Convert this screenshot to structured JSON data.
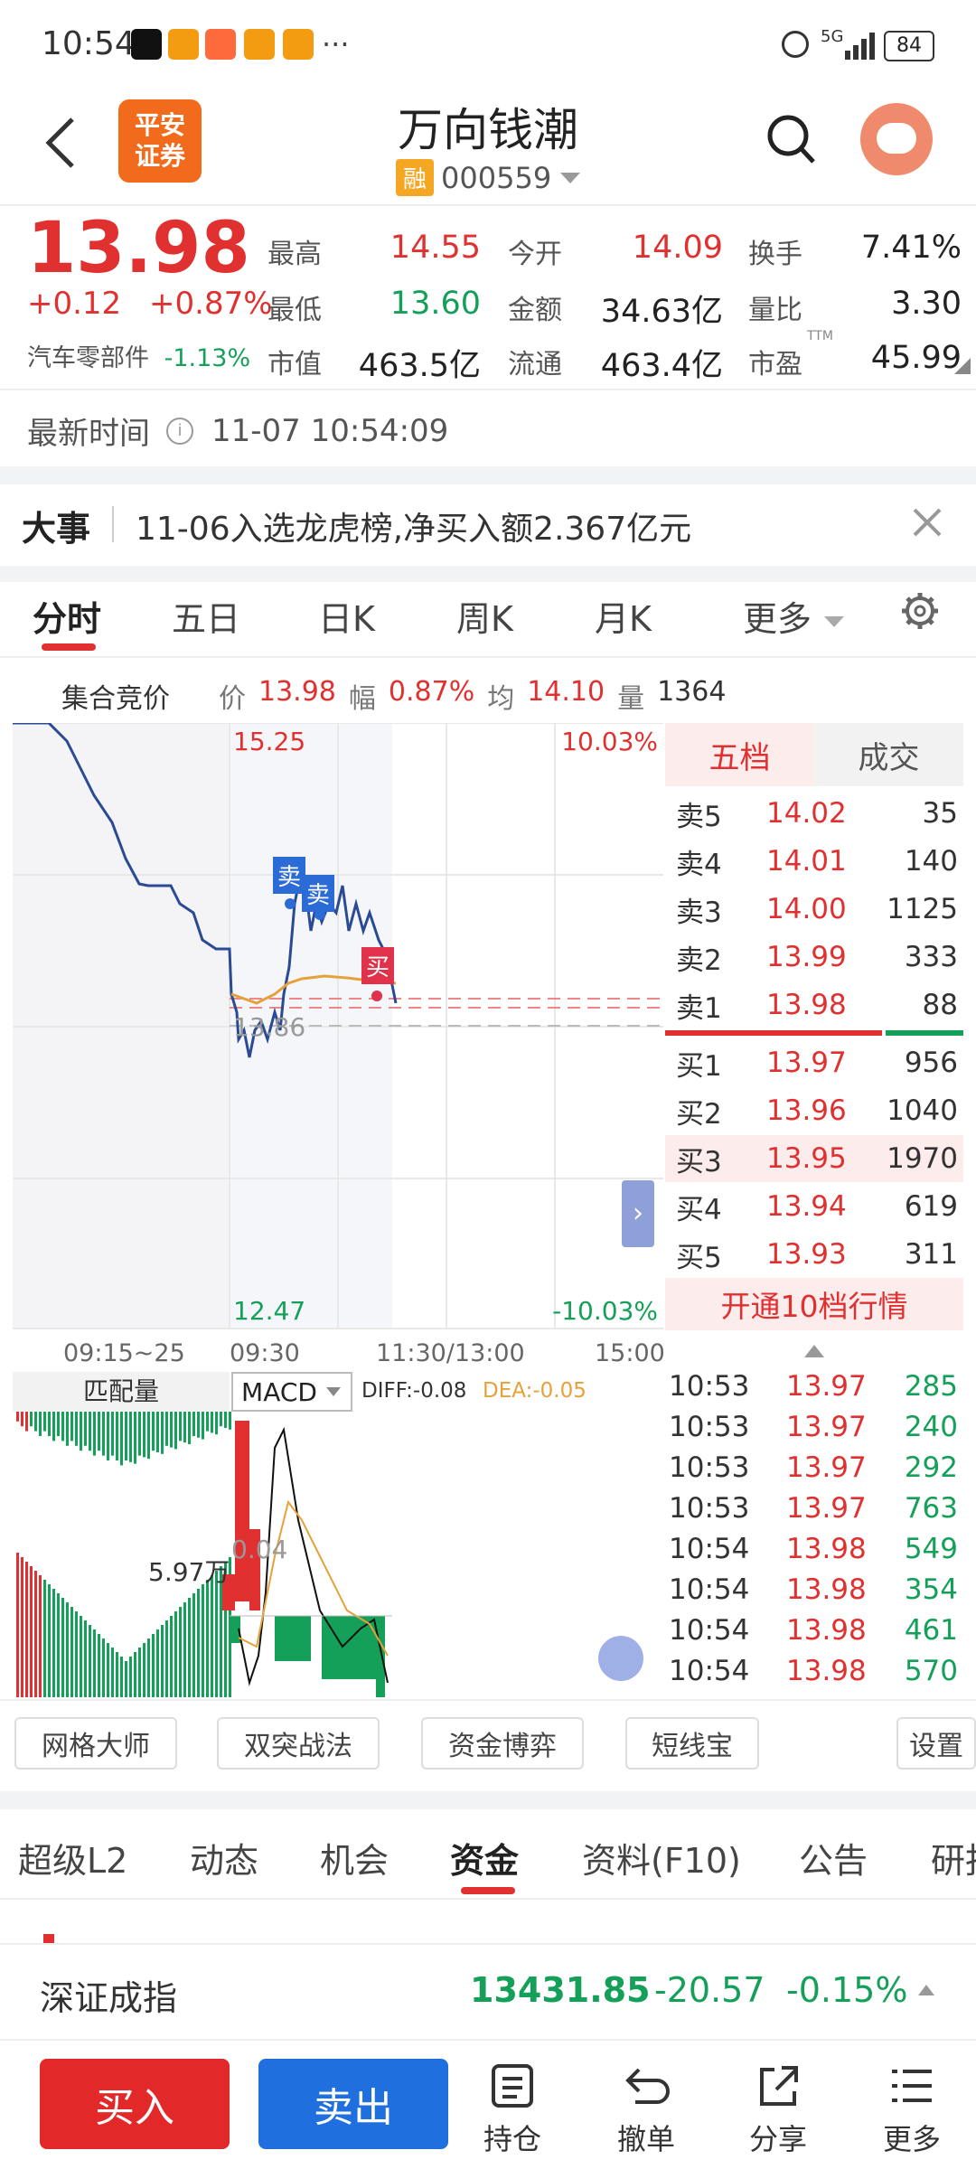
{
  "status_bar": {
    "time": "10:54",
    "extra": "···",
    "battery": "84",
    "network": "5G"
  },
  "header": {
    "title": "万向钱潮",
    "rong": "融",
    "code": "000559",
    "logo_line1": "平安",
    "logo_line2": "证券"
  },
  "quote": {
    "price": "13.98",
    "change": "+0.12",
    "change_pct": "+0.87%",
    "industry": "汽车零部件",
    "industry_pct": "-1.13%",
    "cells": [
      {
        "label": "最高",
        "value": "14.55",
        "color": "#e03030"
      },
      {
        "label": "今开",
        "value": "14.09",
        "color": "#e03030"
      },
      {
        "label": "换手",
        "value": "7.41%",
        "color": "#222222"
      },
      {
        "label": "最低",
        "value": "13.60",
        "color": "#15a05a"
      },
      {
        "label": "金额",
        "value": "34.63亿",
        "color": "#222222"
      },
      {
        "label": "量比",
        "value": "3.30",
        "color": "#222222"
      },
      {
        "label": "市值",
        "value": "463.5亿",
        "color": "#222222"
      },
      {
        "label": "流通",
        "value": "463.4亿",
        "color": "#222222"
      },
      {
        "label": "市盈",
        "value": "45.99",
        "color": "#222222"
      }
    ],
    "ttm": "TTM"
  },
  "latest_time": {
    "label": "最新时间",
    "value": "11-07 10:54:09"
  },
  "news": {
    "tag": "大事",
    "text": "11-06入选龙虎榜,净买入额2.367亿元"
  },
  "tabs": [
    "分时",
    "五日",
    "日K",
    "周K",
    "月K",
    "更多"
  ],
  "info_bar": {
    "auction": "集合竞价",
    "price_label": "价",
    "price": "13.98",
    "range_label": "幅",
    "range": "0.87%",
    "avg_label": "均",
    "avg": "14.10",
    "vol_label": "量",
    "vol": "1364"
  },
  "chart_data": {
    "type": "line",
    "y_top": "15.25",
    "y_bottom": "12.47",
    "pct_top": "10.03%",
    "pct_bottom": "-10.03%",
    "prev_close": "13.86",
    "x_labels": [
      "09:15~25",
      "09:30",
      "11:30/13:00",
      "15:00"
    ],
    "markers": [
      "卖",
      "卖",
      "买"
    ]
  },
  "order_book": {
    "tab_active": "五档",
    "tab_other": "成交",
    "asks": [
      {
        "label": "卖5",
        "price": "14.02",
        "vol": "35"
      },
      {
        "label": "卖4",
        "price": "14.01",
        "vol": "140"
      },
      {
        "label": "卖3",
        "price": "14.00",
        "vol": "1125"
      },
      {
        "label": "卖2",
        "price": "13.99",
        "vol": "333"
      },
      {
        "label": "卖1",
        "price": "13.98",
        "vol": "88"
      }
    ],
    "bids": [
      {
        "label": "买1",
        "price": "13.97",
        "vol": "956"
      },
      {
        "label": "买2",
        "price": "13.96",
        "vol": "1040"
      },
      {
        "label": "买3",
        "price": "13.95",
        "vol": "1970"
      },
      {
        "label": "买4",
        "price": "13.94",
        "vol": "619"
      },
      {
        "label": "买5",
        "price": "13.93",
        "vol": "311"
      }
    ],
    "open10": "开通10档行情"
  },
  "indicator": {
    "match_label": "匹配量",
    "macd": "MACD",
    "diff": "DIFF:-0.08",
    "dea": "DEA:-0.05",
    "vol_label": "5.97万",
    "macd_val": "0.04"
  },
  "ticks": [
    {
      "time": "10:53",
      "price": "13.97",
      "vol": "285"
    },
    {
      "time": "10:53",
      "price": "13.97",
      "vol": "240"
    },
    {
      "time": "10:53",
      "price": "13.97",
      "vol": "292"
    },
    {
      "time": "10:53",
      "price": "13.97",
      "vol": "763"
    },
    {
      "time": "10:54",
      "price": "13.98",
      "vol": "549"
    },
    {
      "time": "10:54",
      "price": "13.98",
      "vol": "354"
    },
    {
      "time": "10:54",
      "price": "13.98",
      "vol": "461"
    },
    {
      "time": "10:54",
      "price": "13.98",
      "vol": "570"
    }
  ],
  "tools": [
    "网格大师",
    "双突战法",
    "资金博弈",
    "短线宝",
    "设置"
  ],
  "news_tabs": [
    "超级L2",
    "动态",
    "机会",
    "资金",
    "资料(F10)",
    "公告",
    "研报"
  ],
  "index_bar": {
    "name": "深证成指",
    "value": "13431.85",
    "change": "-20.57",
    "pct": "-0.15%"
  },
  "bottom": {
    "buy": "买入",
    "sell": "卖出",
    "hold": "持仓",
    "cancel": "撤单",
    "share": "分享",
    "more": "更多"
  }
}
